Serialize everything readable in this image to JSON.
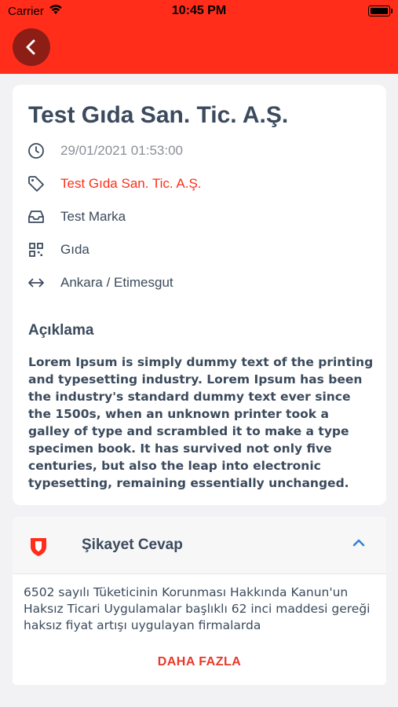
{
  "status_bar": {
    "carrier": "Carrier",
    "time": "10:45 PM"
  },
  "colors": {
    "accent": "#ff2d1a",
    "back_button": "#8c1e16",
    "text": "#3b4a5c",
    "muted": "#8a8f96",
    "link": "#2f80d8"
  },
  "detail": {
    "title": "Test Gıda San. Tic. A.Ş.",
    "rows": [
      {
        "icon": "clock-icon",
        "text": "29/01/2021 01:53:00"
      },
      {
        "icon": "tag-icon",
        "text": "Test Gıda San. Tic. A.Ş."
      },
      {
        "icon": "inbox-icon",
        "text": "Test Marka"
      },
      {
        "icon": "grid-icon",
        "text": "Gıda"
      },
      {
        "icon": "arrows-icon",
        "text": "Ankara / Etimesgut"
      }
    ],
    "description_title": "Açıklama",
    "description": "Lorem Ipsum is simply dummy text of the printing and typesetting industry. Lorem Ipsum has been the industry's standard dummy text ever since the 1500s, when an unknown printer took a galley of type and scrambled it to make a type specimen book. It has survived not only five centuries, but also the leap into electronic typesetting, remaining essentially unchanged."
  },
  "response": {
    "icon": "shield-icon",
    "title": "Şikayet Cevap",
    "expanded_icon": "chevron-up-icon",
    "body": "6502 sayılı Tüketicinin Korunması Hakkında Kanun'un Haksız Ticari Uygulamalar başlıklı 62 inci maddesi gereği haksız fiyat artışı uygulayan firmalarda",
    "more_label": "DAHA FAZLA"
  }
}
